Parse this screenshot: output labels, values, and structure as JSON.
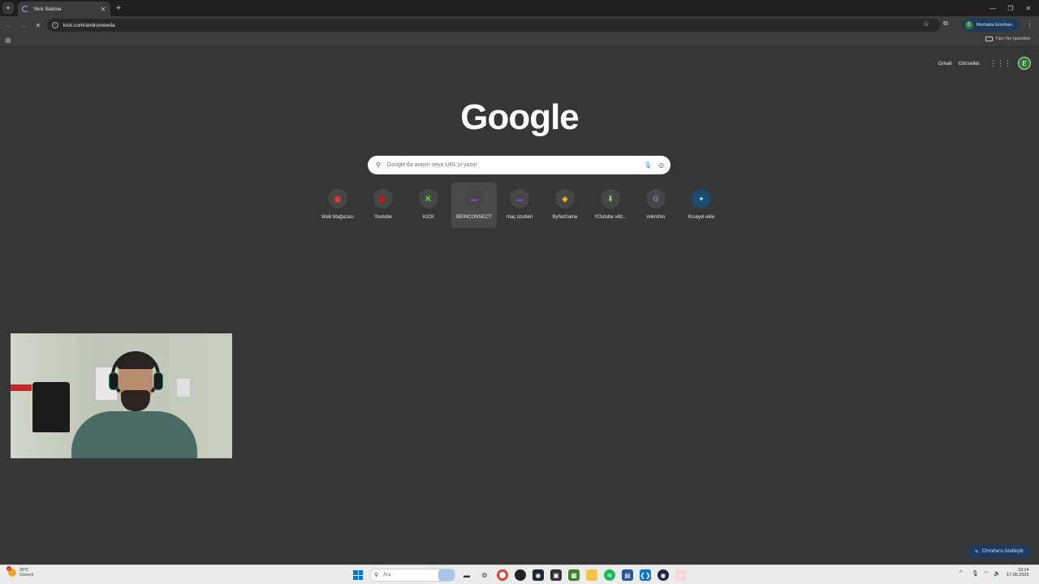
{
  "browser": {
    "tab_title": "Yeni Sekme",
    "url": "kick.com/andromeeda",
    "profile_label": "Merhaba Emirhan,",
    "profile_initial": "E",
    "bookmarks_all": "Tüm Yer İşaretleri"
  },
  "newtab": {
    "top_links": [
      "Gmail",
      "Görseller"
    ],
    "avatar_initial": "E",
    "logo": "Google",
    "search_placeholder": "Google'da arayın veya URL'yi yazın",
    "shortcuts": [
      {
        "label": "Web Mağazası",
        "icon": "web-store-icon",
        "glyph": "▣",
        "color": "#e53935"
      },
      {
        "label": "Youtube",
        "icon": "youtube-icon",
        "glyph": "▶",
        "color": "#ff0000"
      },
      {
        "label": "KICK",
        "icon": "kick-icon",
        "glyph": "K",
        "color": "#53fc18"
      },
      {
        "label": "BEINCONNECT",
        "icon": "beinconnect-icon",
        "glyph": "▬",
        "color": "#7b3fb5"
      },
      {
        "label": "maç özetleri",
        "icon": "mac-ozetleri-icon",
        "glyph": "▬",
        "color": "#7b3fb5"
      },
      {
        "label": "ByNoGame",
        "icon": "bynogame-icon",
        "glyph": "◆",
        "color": "#f9a825"
      },
      {
        "label": "YOutube vifd...",
        "icon": "download-icon",
        "glyph": "⬇",
        "color": "#9ccc65"
      },
      {
        "label": "mikrofon",
        "icon": "mikrofon-icon",
        "glyph": "G",
        "color": "#7986cb"
      },
      {
        "label": "Kısayol ekle",
        "icon": "add-shortcut-icon",
        "glyph": "+",
        "color": "#ffffff"
      }
    ],
    "customize_label": "Chrome'u özelleştir"
  },
  "taskbar": {
    "weather_temp": "25°C",
    "weather_desc": "Güneyli",
    "weather_badge": "1",
    "search_placeholder": "Ara",
    "time": "10:14",
    "date": "17.06.2025"
  }
}
